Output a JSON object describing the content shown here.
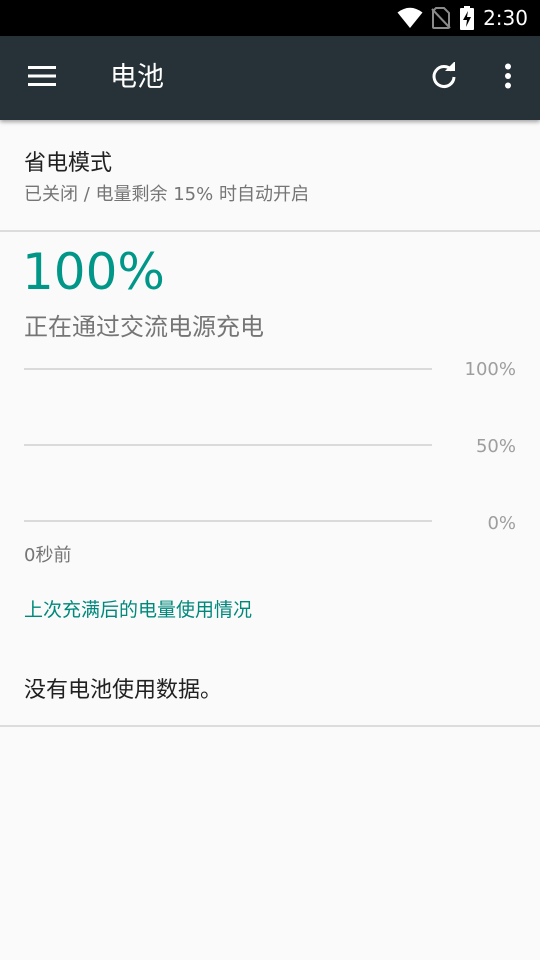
{
  "status_bar": {
    "time": "2:30",
    "icons": [
      "wifi-icon",
      "no-sim-icon",
      "battery-charging-icon"
    ]
  },
  "app_bar": {
    "title": "电池",
    "menu_icon": "menu-icon",
    "refresh_icon": "refresh-icon",
    "overflow_icon": "more-vert-icon"
  },
  "battery_saver": {
    "title": "省电模式",
    "summary": "已关闭 / 电量剩余 15% 时自动开启"
  },
  "battery": {
    "level": "100%",
    "status": "正在通过交流电源充电"
  },
  "chart": {
    "y_labels": [
      "100%",
      "50%",
      "0%"
    ],
    "time_label": "0秒前"
  },
  "usage": {
    "link": "上次充满后的电量使用情况",
    "empty": "没有电池使用数据。"
  },
  "colors": {
    "accent": "#009688",
    "app_bar": "#263238",
    "status_bar": "#000000",
    "background": "#fafafa"
  }
}
